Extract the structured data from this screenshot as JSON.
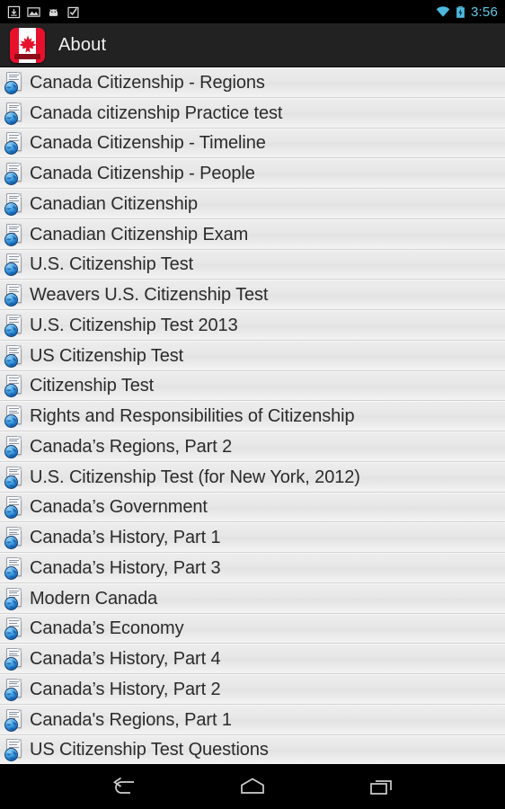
{
  "status_bar": {
    "notification_icons": [
      "download-icon",
      "image-icon",
      "android-head-icon",
      "clipboard-check-icon"
    ],
    "wifi_icon": "wifi-icon",
    "battery_icon": "battery-charging-icon",
    "time": "3:56",
    "time_color": "#5fc8e8"
  },
  "action_bar": {
    "app_icon": "canada-flag-icon",
    "title": "About",
    "background_color": "#222222",
    "title_color": "#f2f2f2"
  },
  "list": {
    "row_icon": "html-document-globe-icon",
    "items": [
      {
        "label": "Canada Citizenship - Regions"
      },
      {
        "label": "Canada citizenship Practice test"
      },
      {
        "label": "Canada Citizenship - Timeline"
      },
      {
        "label": "Canada Citizenship - People"
      },
      {
        "label": "Canadian Citizenship"
      },
      {
        "label": "Canadian Citizenship Exam"
      },
      {
        "label": "U.S. Citizenship Test"
      },
      {
        "label": "Weavers U.S. Citizenship Test"
      },
      {
        "label": "U.S. Citizenship Test 2013"
      },
      {
        "label": "US Citizenship Test"
      },
      {
        "label": "Citizenship Test"
      },
      {
        "label": "Rights and Responsibilities of Citizenship"
      },
      {
        "label": "Canada’s Regions, Part 2"
      },
      {
        "label": "U.S. Citizenship Test (for New York, 2012)"
      },
      {
        "label": "Canada’s Government"
      },
      {
        "label": "Canada’s History, Part 1"
      },
      {
        "label": "Canada’s History, Part 3"
      },
      {
        "label": "Modern Canada"
      },
      {
        "label": "Canada’s Economy"
      },
      {
        "label": "Canada’s History, Part 4"
      },
      {
        "label": "Canada’s History, Part 2"
      },
      {
        "label": "Canada's Regions, Part 1"
      },
      {
        "label": "US Citizenship Test Questions"
      }
    ]
  },
  "nav_bar": {
    "buttons": [
      {
        "name": "back-icon"
      },
      {
        "name": "home-icon"
      },
      {
        "name": "recents-icon"
      }
    ]
  }
}
